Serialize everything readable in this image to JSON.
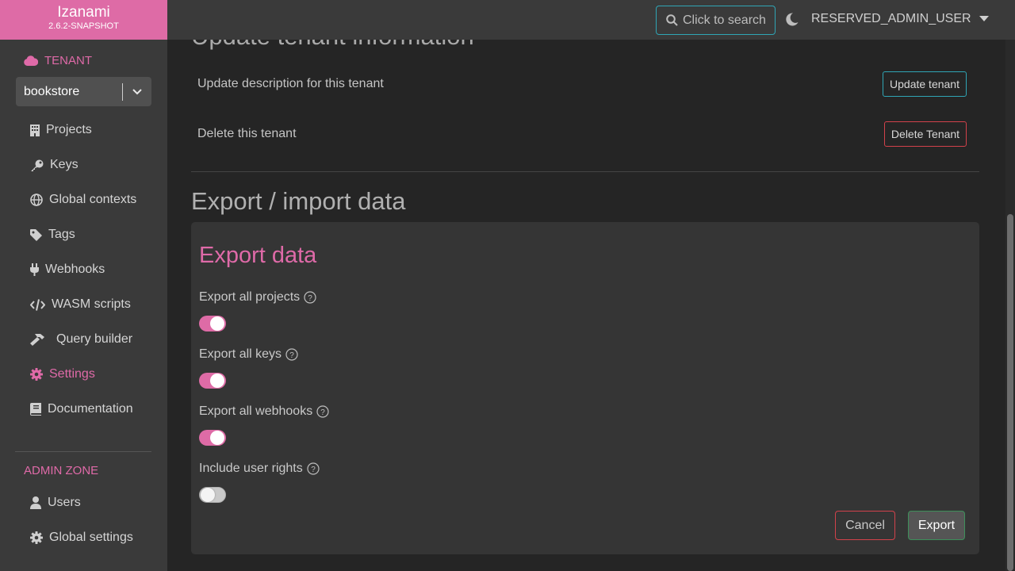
{
  "brand": {
    "name": "Izanami",
    "version": "2.6.2-SNAPSHOT"
  },
  "sidebar": {
    "tenant_heading": "TENANT",
    "tenant_selected": "bookstore",
    "items": [
      {
        "label": "Projects",
        "icon": "building-icon"
      },
      {
        "label": "Keys",
        "icon": "key-icon"
      },
      {
        "label": "Global contexts",
        "icon": "globe-icon"
      },
      {
        "label": "Tags",
        "icon": "tag-icon"
      },
      {
        "label": "Webhooks",
        "icon": "plug-icon"
      },
      {
        "label": "WASM scripts",
        "icon": "code-icon"
      },
      {
        "label": "Query builder",
        "icon": "hammer-icon"
      },
      {
        "label": "Settings",
        "icon": "gear-icon",
        "active": true
      },
      {
        "label": "Documentation",
        "icon": "book-icon"
      }
    ],
    "admin_heading": "ADMIN ZONE",
    "admin_items": [
      {
        "label": "Users",
        "icon": "user-icon"
      },
      {
        "label": "Global settings",
        "icon": "gear-icon"
      }
    ]
  },
  "topbar": {
    "search_placeholder": "Click to search",
    "username": "RESERVED_ADMIN_USER"
  },
  "main": {
    "update_section_title": "Update tenant information",
    "update_description_text": "Update description for this tenant",
    "update_button": "Update tenant",
    "delete_text": "Delete this tenant",
    "delete_button": "Delete Tenant",
    "export_section_title": "Export / import data",
    "export_card": {
      "title": "Export data",
      "options": [
        {
          "label": "Export all projects",
          "checked": true
        },
        {
          "label": "Export all keys",
          "checked": true
        },
        {
          "label": "Export all webhooks",
          "checked": true
        },
        {
          "label": "Include user rights",
          "checked": false
        }
      ],
      "cancel_label": "Cancel",
      "export_label": "Export"
    }
  },
  "colors": {
    "accent": "#de6ba6",
    "teal": "#2fa5b5",
    "danger": "#d2424b"
  }
}
